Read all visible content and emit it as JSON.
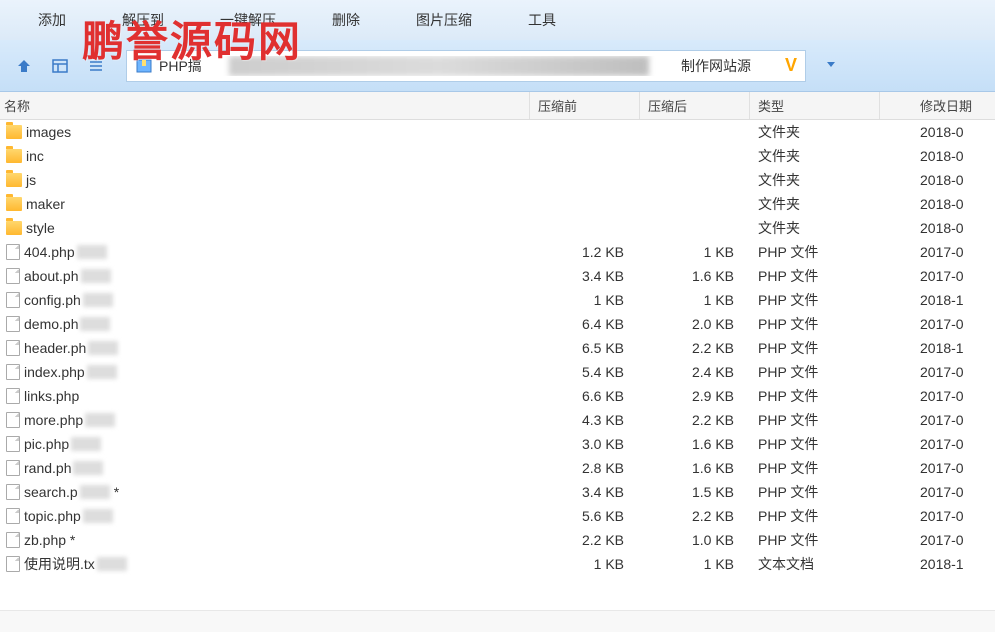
{
  "watermark": "鹏誉源码网",
  "toolbar": {
    "items": [
      "添加",
      "解压到",
      "一键解压",
      "删除",
      "图片压缩",
      "工具"
    ]
  },
  "nav": {
    "path_prefix": "PHP搞",
    "path_suffix": "制作网站源",
    "v_badge": "V"
  },
  "columns": {
    "name": "名称",
    "before": "压缩前",
    "after": "压缩后",
    "type": "类型",
    "date": "修改日期"
  },
  "files": [
    {
      "icon": "folder",
      "name": "images",
      "before": "",
      "after": "",
      "type": "文件夹",
      "date": "2018-0"
    },
    {
      "icon": "folder",
      "name": "inc",
      "before": "",
      "after": "",
      "type": "文件夹",
      "date": "2018-0"
    },
    {
      "icon": "folder",
      "name": "js",
      "before": "",
      "after": "",
      "type": "文件夹",
      "date": "2018-0"
    },
    {
      "icon": "folder",
      "name": "maker",
      "before": "",
      "after": "",
      "type": "文件夹",
      "date": "2018-0"
    },
    {
      "icon": "folder",
      "name": "style",
      "before": "",
      "after": "",
      "type": "文件夹",
      "date": "2018-0"
    },
    {
      "icon": "file",
      "name": "404.php",
      "blur": true,
      "before": "1.2 KB",
      "after": "1 KB",
      "type": "PHP 文件",
      "date": "2017-0"
    },
    {
      "icon": "file",
      "name": "about.ph",
      "blur": true,
      "before": "3.4 KB",
      "after": "1.6 KB",
      "type": "PHP 文件",
      "date": "2017-0"
    },
    {
      "icon": "file",
      "name": "config.ph",
      "blur": true,
      "before": "1 KB",
      "after": "1 KB",
      "type": "PHP 文件",
      "date": "2018-1"
    },
    {
      "icon": "file",
      "name": "demo.ph",
      "blur": true,
      "before": "6.4 KB",
      "after": "2.0 KB",
      "type": "PHP 文件",
      "date": "2017-0"
    },
    {
      "icon": "file",
      "name": "header.ph",
      "blur": true,
      "before": "6.5 KB",
      "after": "2.2 KB",
      "type": "PHP 文件",
      "date": "2018-1"
    },
    {
      "icon": "file",
      "name": "index.php",
      "blur": true,
      "before": "5.4 KB",
      "after": "2.4 KB",
      "type": "PHP 文件",
      "date": "2017-0"
    },
    {
      "icon": "file",
      "name": "links.php",
      "before": "6.6 KB",
      "after": "2.9 KB",
      "type": "PHP 文件",
      "date": "2017-0"
    },
    {
      "icon": "file",
      "name": "more.php",
      "blur": true,
      "before": "4.3 KB",
      "after": "2.2 KB",
      "type": "PHP 文件",
      "date": "2017-0"
    },
    {
      "icon": "file",
      "name": "pic.php",
      "blur": true,
      "before": "3.0 KB",
      "after": "1.6 KB",
      "type": "PHP 文件",
      "date": "2017-0"
    },
    {
      "icon": "file",
      "name": "rand.ph",
      "blur": true,
      "before": "2.8 KB",
      "after": "1.6 KB",
      "type": "PHP 文件",
      "date": "2017-0"
    },
    {
      "icon": "file",
      "name": "search.p",
      "blur": true,
      "suffix": " *",
      "before": "3.4 KB",
      "after": "1.5 KB",
      "type": "PHP 文件",
      "date": "2017-0"
    },
    {
      "icon": "file",
      "name": "topic.php",
      "blur": true,
      "before": "5.6 KB",
      "after": "2.2 KB",
      "type": "PHP 文件",
      "date": "2017-0"
    },
    {
      "icon": "file",
      "name": "zb.php *",
      "before": "2.2 KB",
      "after": "1.0 KB",
      "type": "PHP 文件",
      "date": "2017-0"
    },
    {
      "icon": "file",
      "name": "使用说明.tx",
      "blur": true,
      "before": "1 KB",
      "after": "1 KB",
      "type": "文本文档",
      "date": "2018-1"
    }
  ]
}
